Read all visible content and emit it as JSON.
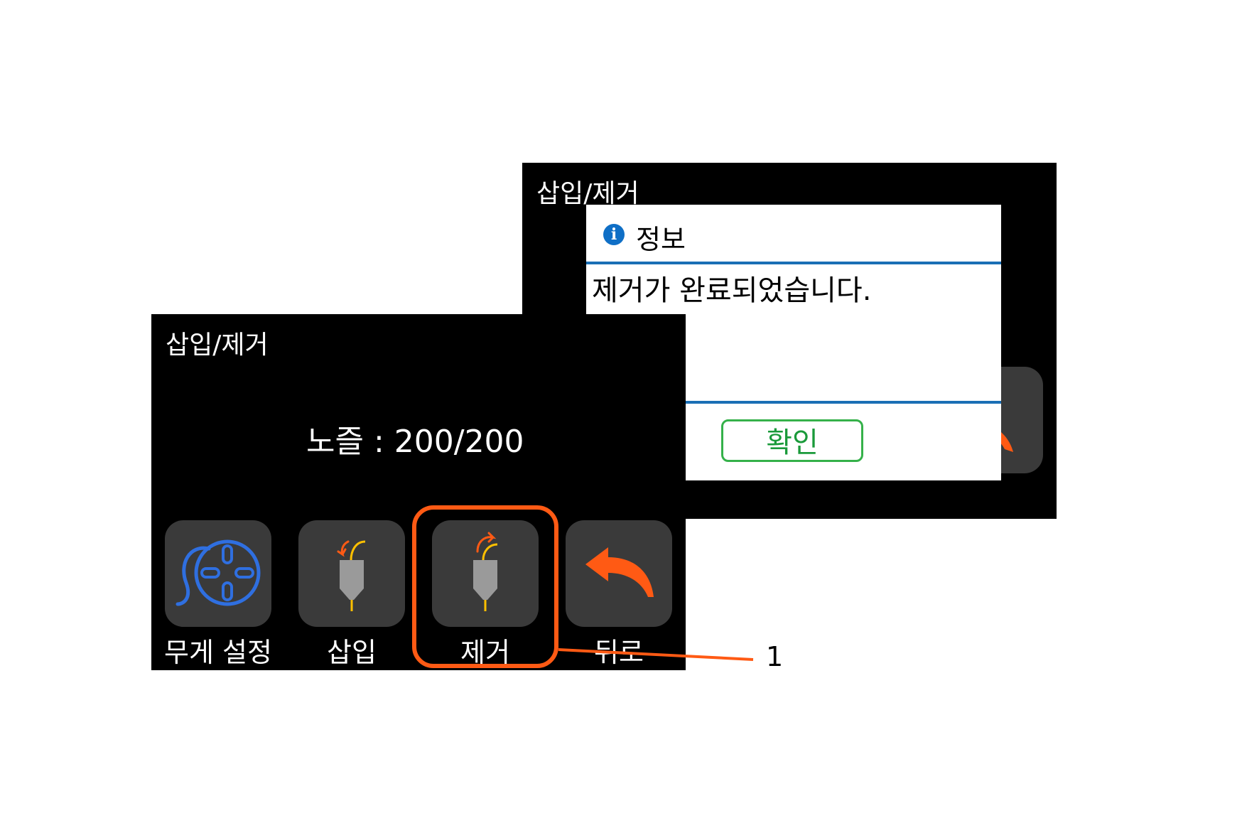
{
  "back_screen": {
    "title": "삽입/제거",
    "dialog": {
      "icon": "info-icon",
      "icon_glyph": "i",
      "title": "정보",
      "message": "제거가 완료되었습니다.",
      "ok_label": "확인"
    }
  },
  "front_screen": {
    "title": "삽입/제거",
    "nozzle_readout": "노즐 : 200/200",
    "buttons": [
      {
        "label": "무게 설정",
        "icon": "filament-spool-icon"
      },
      {
        "label": "삽입",
        "icon": "nozzle-insert-icon"
      },
      {
        "label": "제거",
        "icon": "nozzle-remove-icon"
      },
      {
        "label": "뒤로",
        "icon": "back-arrow-icon"
      }
    ]
  },
  "callout": {
    "label": "1",
    "color": "#ff5a14"
  },
  "colors": {
    "screen_bg": "#000000",
    "tile_bg": "#3a3a3a",
    "accent_blue": "#1a6fb5",
    "ok_green": "#35b14a",
    "highlight_orange": "#ff5a14"
  }
}
